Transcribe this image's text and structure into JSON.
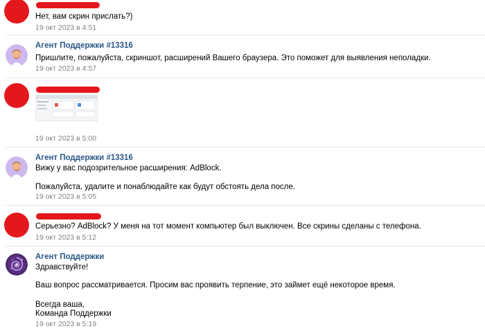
{
  "messages": [
    {
      "lines": [
        "Нет, вам скрин прислать?)"
      ],
      "time": "19 окт 2023 в 4:51"
    },
    {
      "author": "Агент Поддержки #13316",
      "lines": [
        "Пришлите, пожалуйста, скриншот, расширений Вашего браузера. Это поможет для выявления неполадки."
      ],
      "time": "19 окт 2023 в 4:57"
    },
    {
      "time": "19 окт 2023 в 5:00"
    },
    {
      "author": "Агент Поддержки #13316",
      "lines": [
        "Вижу у вас подозрительное расширения: AdBlock.",
        "Пожалуйста, удалите и понаблюдайте как будут обстоять дела после."
      ],
      "time": "19 окт 2023 в 5:05"
    },
    {
      "lines": [
        "Серьезно? AdBlock? У меня на тот момент компьютер был выключен. Все скрины сделаны с телефона."
      ],
      "time": "19 окт 2023 в 5:12"
    },
    {
      "author": "Агент Поддержки",
      "lines": [
        "Здравствуйте!",
        "Ваш вопрос рассматривается. Просим вас проявить терпение, это займет ещё некоторое время.",
        "Всегда ваша,",
        "Команда Поддержки"
      ],
      "time": "19 окт 2023 в 5:19"
    }
  ]
}
